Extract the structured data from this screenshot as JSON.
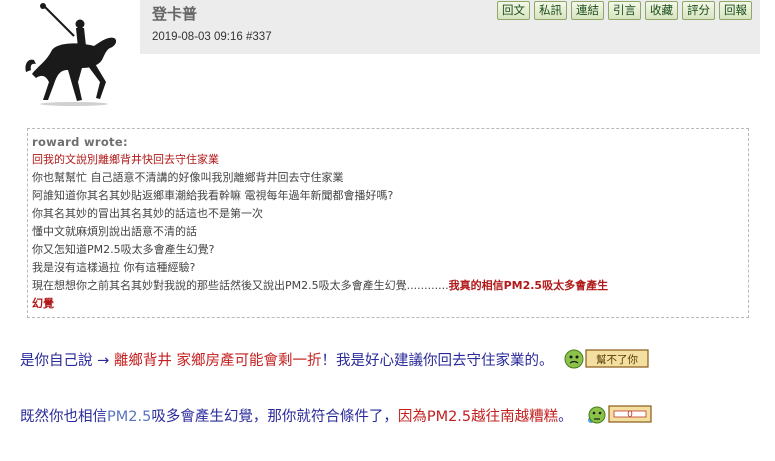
{
  "post": {
    "username": "登卡普",
    "datetime": "2019-08-03 09:16",
    "post_number": "#337",
    "actions": [
      "回文",
      "私訊",
      "連結",
      "引言",
      "收藏",
      "評分",
      "回報"
    ]
  },
  "quote": {
    "author": "roward wrote:",
    "lines": [
      "回我的文說別離鄉背井快回去守住家業",
      "你也幫幫忙 自己語意不清講的好像叫我別離鄉背井回去守住家業",
      "阿誰知道你其名其妙貼返鄉車潮給我看幹嘛 電視每年過年新聞都會播好嗎?",
      "你其名其妙的冒出其名其妙的話這也不是第一次",
      "懂中文就麻煩別說出語意不清的話",
      "你又怎知道PM2.5吸太多會產生幻覺?",
      "我是沒有這樣過拉 你有這種經驗?",
      "現在想想你之前其名其妙對我說的那些話然後又說出PM2.5吸太多會產生幻覺............",
      "我真的相信PM2.5吸太多會產生",
      "幻覺"
    ]
  },
  "reply1": {
    "part1": "是你自己說 → ",
    "part2": "離鄉背井 家鄉房產可能會剩一折",
    "part3": "！我是好心建議你回去守住家業的。",
    "sticker_text": "幫不了你"
  },
  "reply2": {
    "part1": "既然你也相信",
    "part2": "PM2.5",
    "part3": "吸多會產生幻覺，那你就符合條件了，",
    "part4": "因為PM2.5越往南越糟糕",
    "part5": "。",
    "sticker_text": "0"
  },
  "colors": {
    "header_bg": "#ececec",
    "button_green": "#d7e4bf",
    "quote_red": "#b11a1a",
    "reply_blue": "#2a2a9a"
  }
}
